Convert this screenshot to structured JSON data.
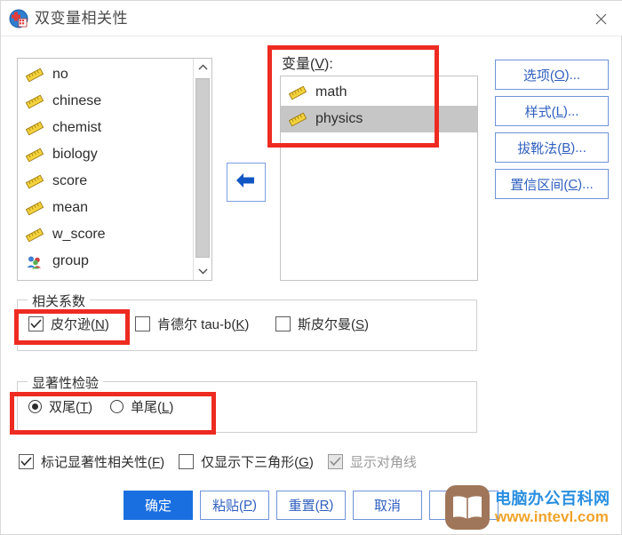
{
  "window": {
    "title": "双变量相关性",
    "app_icon": "spss-correlations-icon",
    "close_label": "✕"
  },
  "source_list": {
    "name": "source-variable-list",
    "items": [
      {
        "label": "no",
        "icon": "scale-ruler-icon"
      },
      {
        "label": "chinese",
        "icon": "scale-ruler-icon"
      },
      {
        "label": "chemist",
        "icon": "scale-ruler-icon"
      },
      {
        "label": "biology",
        "icon": "scale-ruler-icon"
      },
      {
        "label": "score",
        "icon": "scale-ruler-icon"
      },
      {
        "label": "mean",
        "icon": "scale-ruler-icon"
      },
      {
        "label": "w_score",
        "icon": "scale-ruler-icon"
      },
      {
        "label": "group",
        "icon": "nominal-group-icon"
      }
    ],
    "scroll_up": "⌃",
    "scroll_down": "⌄"
  },
  "transfer": {
    "label": "move-to-variables",
    "icon": "left-arrow-icon"
  },
  "variables_panel": {
    "label_prefix": "变量(",
    "label_key": "V",
    "label_suffix": "):",
    "items": [
      {
        "label": "math",
        "icon": "scale-ruler-icon",
        "selected": false
      },
      {
        "label": "physics",
        "icon": "scale-ruler-icon",
        "selected": true
      }
    ]
  },
  "side_buttons": [
    {
      "name": "options-button",
      "prefix": "选项(",
      "key": "O",
      "suffix": ")..."
    },
    {
      "name": "styles-button",
      "prefix": "样式(",
      "key": "L",
      "suffix": ")..."
    },
    {
      "name": "bootstrap-button",
      "prefix": "拔靴法(",
      "key": "B",
      "suffix": ")..."
    },
    {
      "name": "confidence-interval-button",
      "prefix": "置信区间(",
      "key": "C",
      "suffix": ")..."
    }
  ],
  "correlation_group": {
    "title": "相关系数",
    "options": [
      {
        "name": "pearson",
        "prefix": "皮尔逊(",
        "key": "N",
        "suffix": ")",
        "checked": true
      },
      {
        "name": "kendall",
        "prefix": "肯德尔 tau-b(",
        "key": "K",
        "suffix": ")",
        "checked": false
      },
      {
        "name": "spearman",
        "prefix": "斯皮尔曼(",
        "key": "S",
        "suffix": ")",
        "checked": false
      }
    ]
  },
  "significance_group": {
    "title": "显著性检验",
    "options": [
      {
        "name": "two-tailed",
        "prefix": "双尾(",
        "key": "T",
        "suffix": ")",
        "selected": true
      },
      {
        "name": "one-tailed",
        "prefix": "单尾(",
        "key": "L",
        "suffix": ")",
        "selected": false
      }
    ]
  },
  "bottom_options": [
    {
      "name": "flag-significant",
      "prefix": "标记显著性相关性(",
      "key": "F",
      "suffix": ")",
      "checked": true,
      "disabled": false
    },
    {
      "name": "show-lower-triangle",
      "prefix": "仅显示下三角形(",
      "key": "G",
      "suffix": ")",
      "checked": false,
      "disabled": false
    },
    {
      "name": "show-diagonal",
      "prefix": "显示对角线",
      "key": "",
      "suffix": "",
      "checked": true,
      "disabled": true
    }
  ],
  "actions": [
    {
      "name": "ok-button",
      "prefix": "确定",
      "key": "",
      "suffix": "",
      "primary": true
    },
    {
      "name": "paste-button",
      "prefix": "粘贴(",
      "key": "P",
      "suffix": ")",
      "primary": false
    },
    {
      "name": "reset-button",
      "prefix": "重置(",
      "key": "R",
      "suffix": ")",
      "primary": false
    },
    {
      "name": "cancel-button",
      "prefix": "取消",
      "key": "",
      "suffix": "",
      "primary": false
    },
    {
      "name": "help-button",
      "prefix": "",
      "key": "",
      "suffix": "",
      "primary": false
    }
  ],
  "annotations": [
    {
      "name": "annotation-variables-box",
      "color": "#ee2b21"
    },
    {
      "name": "annotation-pearson-box",
      "color": "#ee2b21"
    },
    {
      "name": "annotation-significance-box",
      "color": "#ee2b21"
    }
  ],
  "watermark": {
    "site_name": "电脑办公百科网",
    "site_url": "www.intevl.com",
    "icon": "book-icon"
  }
}
